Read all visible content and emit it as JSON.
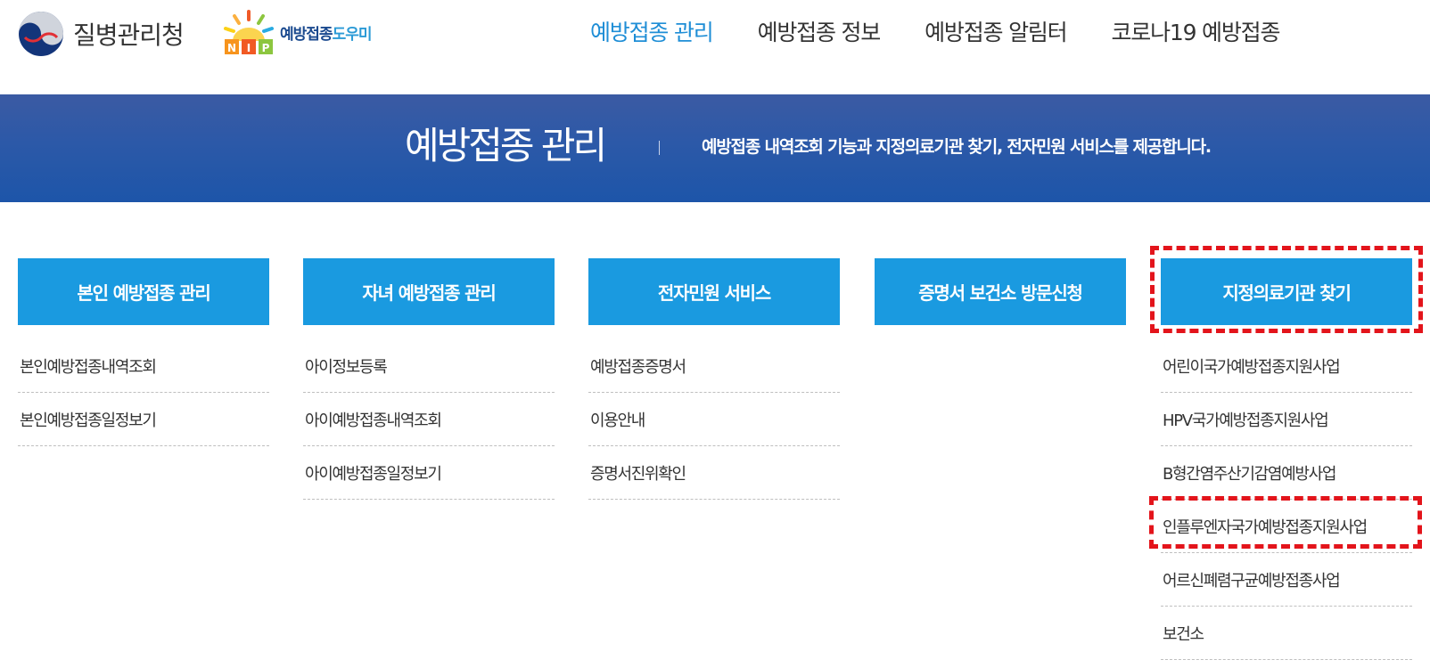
{
  "header": {
    "org_name": "질병관리청",
    "org_logo_icon": "kdca-emblem-icon",
    "nip_logo_text": "NIP",
    "nip_name_part1": "예방접종",
    "nip_name_part2": "도우미",
    "nip_logo_icon": "nip-sun-icon",
    "nav": [
      {
        "label": "예방접종 관리",
        "active": true
      },
      {
        "label": "예방접종 정보"
      },
      {
        "label": "예방접종 알림터"
      },
      {
        "label": "코로나19 예방접종"
      }
    ]
  },
  "banner": {
    "title": "예방접종 관리",
    "description": "예방접종 내역조회 기능과 지정의료기관 찾기, 전자민원 서비스를 제공합니다."
  },
  "menu": [
    {
      "title": "본인 예방접종 관리",
      "links": [
        "본인예방접종내역조회",
        "본인예방접종일정보기"
      ]
    },
    {
      "title": "자녀 예방접종 관리",
      "links": [
        "아이정보등록",
        "아이예방접종내역조회",
        "아이예방접종일정보기"
      ]
    },
    {
      "title": "전자민원 서비스",
      "links": [
        "예방접종증명서",
        "이용안내",
        "증명서진위확인"
      ]
    },
    {
      "title": "증명서 보건소 방문신청",
      "links": []
    },
    {
      "title": "지정의료기관 찾기",
      "links": [
        "어린이국가예방접종지원사업",
        "HPV국가예방접종지원사업",
        "B형간염주산기감염예방사업",
        "인플루엔자국가예방접종지원사업",
        "어르신폐렴구균예방접종사업",
        "보건소"
      ]
    }
  ],
  "colors": {
    "accent": "#1f8ed6",
    "button": "#1a9ae0",
    "banner": "#2c59a8",
    "highlight": "#e3141b"
  }
}
